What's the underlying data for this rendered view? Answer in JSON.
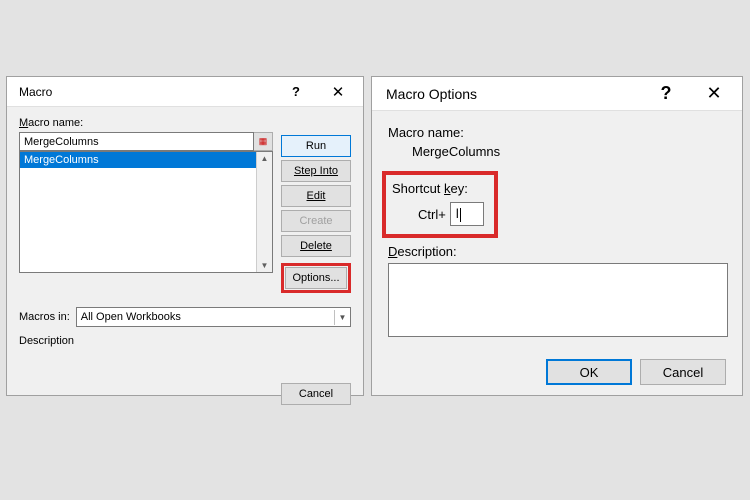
{
  "macro_dialog": {
    "title": "Macro",
    "macro_name_label_pre": "M",
    "macro_name_label_post": "acro name:",
    "macro_name_value": "MergeColumns",
    "list_items": [
      "MergeColumns"
    ],
    "buttons": {
      "run": "Run",
      "step_into": "Step Into",
      "edit": "Edit",
      "create": "Create",
      "delete": "Delete",
      "options": "Options..."
    },
    "macros_in_label_pre": "M",
    "macros_in_label_post": "acros in:",
    "macros_in_value": "All Open Workbooks",
    "description_label": "Description",
    "cancel": "Cancel"
  },
  "options_dialog": {
    "title": "Macro Options",
    "macro_name_label": "Macro name:",
    "macro_name_value": "MergeColumns",
    "shortcut_label_pre": "Shortcut ",
    "shortcut_label_u": "k",
    "shortcut_label_post": "ey:",
    "ctrl_label": "Ctrl+",
    "shortcut_value": "l",
    "description_label_u": "D",
    "description_label_post": "escription:",
    "description_value": "",
    "ok": "OK",
    "cancel": "Cancel"
  }
}
